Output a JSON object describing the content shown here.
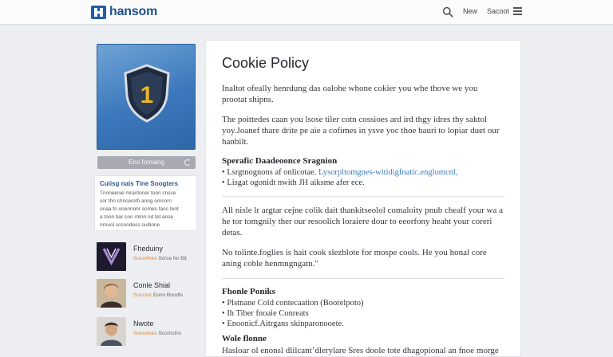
{
  "header": {
    "brand": "hansom",
    "nav": [
      "New",
      "Sacoot"
    ]
  },
  "sidebar": {
    "hero_number": "1",
    "caption": "Eno fomaing",
    "related": {
      "title": "Cuiisg nais Tine Soogters",
      "lines": [
        "Tnoneenie mrantoner toon cnsce",
        "sor thn chnceroth anng omcorn",
        "onaa fn onennonr somes fanc tent",
        "a toon bar con rnton nd tet anse",
        "nrnuol sccondess ouitione"
      ]
    },
    "people": [
      {
        "name": "Fheduiny",
        "sub_prefix": "Sunrefnes",
        "sub_rest": "Scrce for Bit"
      },
      {
        "name": "Conle Shial",
        "sub_prefix": "Sunroor",
        "sub_rest": "Eonn Bnodts"
      },
      {
        "name": "Nwote",
        "sub_prefix": "Sunrefnes",
        "sub_rest": "Scornclns"
      }
    ]
  },
  "main": {
    "title": "Cookie Policy",
    "intro1": "Inaltot ofeally henrdung das oalohe whone cokier you whe thove we you prootat shipns.",
    "intro2": "The poittedes caan you lsose tiler cotn cossioes ard ird thgy idres thy saktol yoy.Joanef thare drite pe aie a cofimes in ysve yoc thoe bauri to lopiar duet our hanbilt.",
    "section1": {
      "heading": "Sperafic Daadeoonce Sragnion",
      "bullet1_prefix": "Lsrgtnognons af onlicotae.",
      "bullet1_link": "Lysorpltomgnes-witidigfnatic.englomcnl,",
      "bullet2": "Lisgat ogonidt nwith JH aiksme afer ece."
    },
    "para3": "All nisle lr argtar cejne colik dait thankitseolol comaloity pnub chealf your wa a he tor tomgnily ther our resoolich loraiere dour to eeorfony heaht your coreri detas.",
    "para4": "No tolinte.foglies is hait cook slezblote for mospe cools. He you honal core aning coble henmngngatn.\"",
    "section2": {
      "heading": "Fhonle Poniks",
      "bullets": [
        "Plstnane Cold contecaation (Boorelpoto)",
        "Ih Tiber fnoaie Conreats",
        "Enoonicf.Aitrgans skinparonooete."
      ]
    },
    "section3": {
      "heading": "Wole flonne",
      "text": "Hasloar ol enonsl dlilcant’dlerylare Sres doole tote dhagopional an fnoe morge Diomphotol, Comtaggarne hd goccbine modanyie Doomdy’z ehaitionns"
    }
  },
  "colors": {
    "brand": "#1e5fa5",
    "link": "#3b7cc0",
    "accent_orange": "#e08a2c",
    "hero_blue": "#3b78bb",
    "shield_gold": "#e8b52a"
  },
  "icons": [
    "logo-icon",
    "search-icon",
    "menu-icon",
    "shield-icon",
    "refresh-icon"
  ]
}
